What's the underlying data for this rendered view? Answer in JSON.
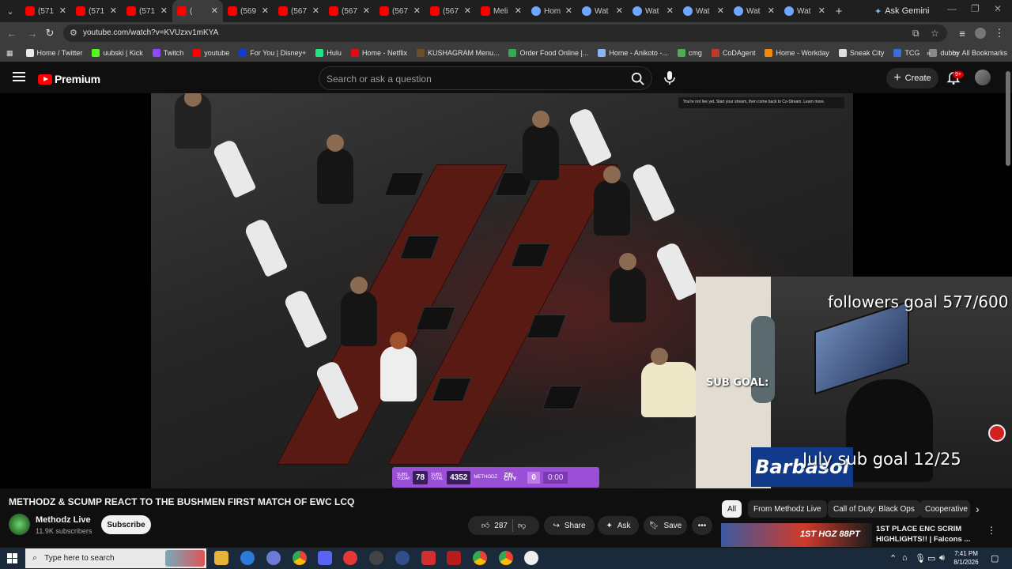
{
  "browser": {
    "tabs": [
      {
        "title": "(571",
        "icon": "youtube-icon"
      },
      {
        "title": "(571",
        "icon": "youtube-icon"
      },
      {
        "title": "(571",
        "icon": "youtube-icon"
      },
      {
        "title": "(",
        "icon": "youtube-icon",
        "active": true
      },
      {
        "title": "(569",
        "icon": "youtube-icon"
      },
      {
        "title": "(567",
        "icon": "youtube-icon"
      },
      {
        "title": "(567",
        "icon": "youtube-icon"
      },
      {
        "title": "(567",
        "icon": "youtube-icon"
      },
      {
        "title": "(567",
        "icon": "youtube-icon"
      },
      {
        "title": "Meli",
        "icon": "youtube-icon"
      },
      {
        "title": "Hom",
        "icon": "globe-icon"
      },
      {
        "title": "Wat",
        "icon": "globe-icon"
      },
      {
        "title": "Wat",
        "icon": "globe-icon"
      },
      {
        "title": "Wat",
        "icon": "globe-icon"
      },
      {
        "title": "Wat",
        "icon": "globe-icon"
      },
      {
        "title": "Wat",
        "icon": "globe-icon"
      }
    ],
    "new_tab": "+",
    "gemini_label": "Ask Gemini",
    "url": "youtube.com/watch?v=KVUzxv1mKYA",
    "bookmarks": [
      {
        "label": "Home / Twitter",
        "color": "#e7e9ea"
      },
      {
        "label": "uubski | Kick",
        "color": "#53fc18"
      },
      {
        "label": "Twitch",
        "color": "#9146ff"
      },
      {
        "label": "youtube",
        "color": "#ff0000"
      },
      {
        "label": "For You | Disney+",
        "color": "#113ccf"
      },
      {
        "label": "Hulu",
        "color": "#1ce783"
      },
      {
        "label": "Home - Netflix",
        "color": "#e50914"
      },
      {
        "label": "KUSHAGRAM Menu...",
        "color": "#6b4f2a"
      },
      {
        "label": "Order Food Online |...",
        "color": "#34a853"
      },
      {
        "label": "Home - Anikoto -...",
        "color": "#8ab4f8"
      },
      {
        "label": "cmg",
        "color": "#4caf50"
      },
      {
        "label": "CoDAgent",
        "color": "#c0392b"
      },
      {
        "label": "Home - Workday",
        "color": "#f38b00"
      },
      {
        "label": "Sneak City",
        "color": "#dddddd"
      },
      {
        "label": "TCG",
        "color": "#3a6fd8"
      },
      {
        "label": "dubby",
        "color": "#888888"
      }
    ],
    "all_bookmarks": "All Bookmarks"
  },
  "youtube": {
    "brand": "Premium",
    "search_placeholder": "Search or ask a question",
    "create_label": "Create",
    "notif_badge": "9+",
    "video": {
      "overlay_notice": "You're not live yet. Start your stream, then come back to Co-Stream. Learn more.",
      "followers_goal": "followers goal 577/600",
      "sub_goal": "SUB GOAL:",
      "july_goal": "July sub goal 12/25",
      "sponsor": "Barbasol",
      "subs_today_label": "SUBS TODAY",
      "subs_today": "78",
      "subs_total_label": "SUBS TOTAL",
      "subs_total": "4352",
      "brand_tag": "METHODZ",
      "team_tag": "ZIN CITY",
      "score": "0",
      "timer": "0:00"
    },
    "title": "METHODZ & SCUMP REACT TO THE BUSHMEN FIRST MATCH OF EWC LCQ",
    "channel": {
      "name": "Methodz Live",
      "subs": "11.9K subscribers",
      "subscribe_label": "Subscribe"
    },
    "actions": {
      "likes": "287",
      "share": "Share",
      "ask": "Ask",
      "save": "Save"
    },
    "chips": [
      "All",
      "From Methodz Live",
      "Call of Duty: Black Ops",
      "Cooperative"
    ],
    "recommended": {
      "thumb_text": "1ST HGZ 88PT",
      "title": "1ST PLACE ENC SCRIM HIGHLIGHTS!! | Falcons ..."
    }
  },
  "taskbar": {
    "search_placeholder": "Type here to search",
    "time": "7:41 PM",
    "date": "8/1/2026"
  }
}
